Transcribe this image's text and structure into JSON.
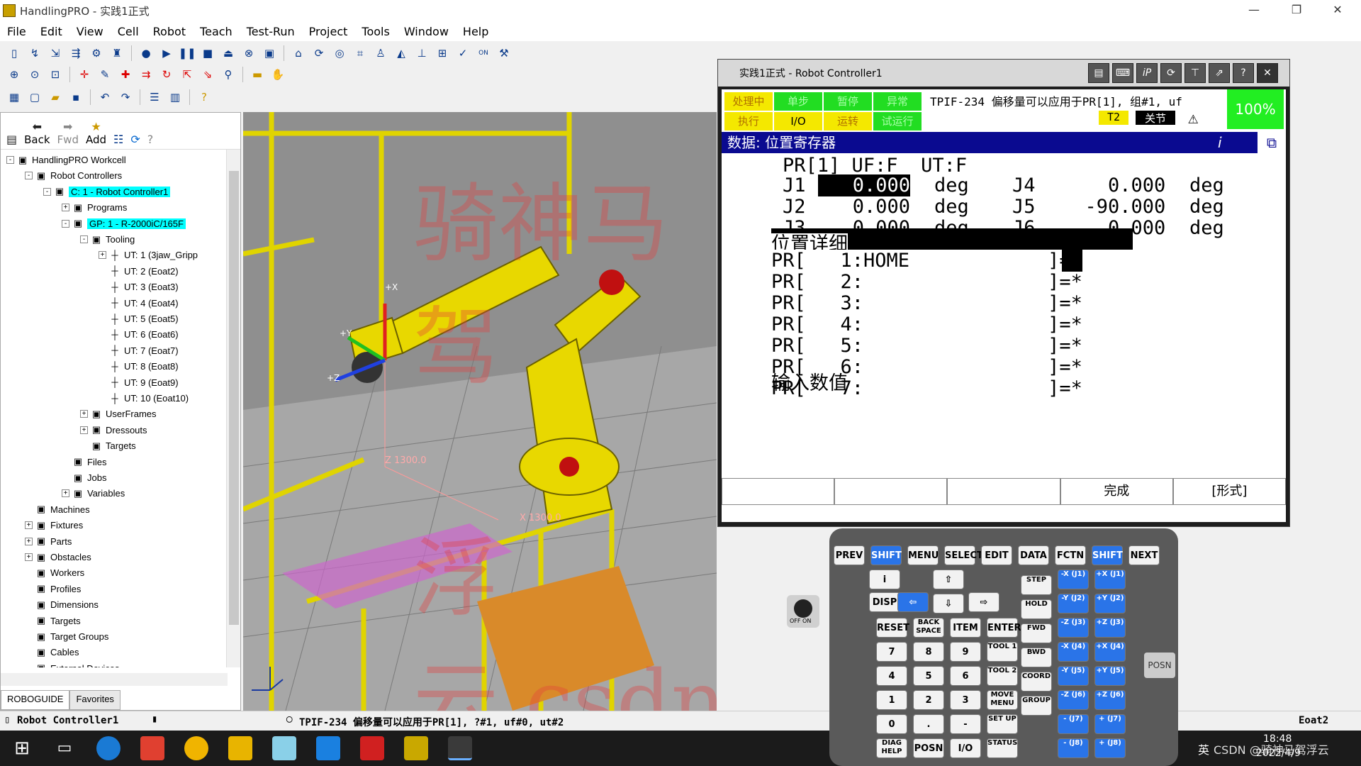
{
  "app": {
    "title": "HandlingPRO - 实践1正式"
  },
  "menu": [
    "File",
    "Edit",
    "View",
    "Cell",
    "Robot",
    "Teach",
    "Test-Run",
    "Project",
    "Tools",
    "Window",
    "Help"
  ],
  "nav": {
    "back": "Back",
    "fwd": "Fwd",
    "add": "Add"
  },
  "tree": [
    {
      "label": "HandlingPRO Workcell",
      "lvl": 0,
      "exp": "-"
    },
    {
      "label": "Robot Controllers",
      "lvl": 1,
      "exp": "-"
    },
    {
      "label": "C: 1 - Robot Controller1",
      "lvl": 2,
      "exp": "-",
      "hl": true
    },
    {
      "label": "Programs",
      "lvl": 3,
      "exp": "+"
    },
    {
      "label": "GP: 1 - R-2000iC/165F",
      "lvl": 3,
      "exp": "-",
      "hl": true
    },
    {
      "label": "Tooling",
      "lvl": 4,
      "exp": "-"
    },
    {
      "label": "UT: 1  (3jaw_Gripp",
      "lvl": 5,
      "exp": "+"
    },
    {
      "label": "UT: 2  (Eoat2)",
      "lvl": 5
    },
    {
      "label": "UT: 3  (Eoat3)",
      "lvl": 5
    },
    {
      "label": "UT: 4  (Eoat4)",
      "lvl": 5
    },
    {
      "label": "UT: 5  (Eoat5)",
      "lvl": 5
    },
    {
      "label": "UT: 6  (Eoat6)",
      "lvl": 5
    },
    {
      "label": "UT: 7  (Eoat7)",
      "lvl": 5
    },
    {
      "label": "UT: 8  (Eoat8)",
      "lvl": 5
    },
    {
      "label": "UT: 9  (Eoat9)",
      "lvl": 5
    },
    {
      "label": "UT: 10  (Eoat10)",
      "lvl": 5
    },
    {
      "label": "UserFrames",
      "lvl": 4,
      "exp": "+"
    },
    {
      "label": "Dressouts",
      "lvl": 4,
      "exp": "+"
    },
    {
      "label": "Targets",
      "lvl": 4
    },
    {
      "label": "Files",
      "lvl": 3
    },
    {
      "label": "Jobs",
      "lvl": 3
    },
    {
      "label": "Variables",
      "lvl": 3,
      "exp": "+"
    },
    {
      "label": "Machines",
      "lvl": 1
    },
    {
      "label": "Fixtures",
      "lvl": 1,
      "exp": "+"
    },
    {
      "label": "Parts",
      "lvl": 1,
      "exp": "+"
    },
    {
      "label": "Obstacles",
      "lvl": 1,
      "exp": "+"
    },
    {
      "label": "Workers",
      "lvl": 1
    },
    {
      "label": "Profiles",
      "lvl": 1
    },
    {
      "label": "Dimensions",
      "lvl": 1
    },
    {
      "label": "Targets",
      "lvl": 1
    },
    {
      "label": "Target Groups",
      "lvl": 1
    },
    {
      "label": "Cables",
      "lvl": 1
    },
    {
      "label": "External Devices",
      "lvl": 1
    }
  ],
  "left_tabs": [
    "ROBOGUIDE",
    "Favorites"
  ],
  "view3d": {
    "z_label": "Z 1300.0",
    "x_label": "X 1300.0",
    "axis_x": "+X",
    "axis_y": "+Y",
    "axis_z": "+Z",
    "wm1": "骑神马驾",
    "wm2": "浮云.csdn"
  },
  "tp": {
    "title": "实践1正式 - Robot Controller1",
    "status_left": [
      "处理中",
      "单步",
      "暂停",
      "异常",
      "执行",
      "I/O",
      "运转",
      "试运行"
    ],
    "message": "TPIF-234 偏移量可以应用于PR[1], 组#1, uf",
    "mode": "T2",
    "off": "关节",
    "percent": "100%",
    "header": "数据: 位置寄存器",
    "pr_line": "PR[1] UF:F  UT:F",
    "joints": [
      {
        "n": "J1",
        "v": "0.000",
        "u": "deg",
        "n2": "J4",
        "v2": "0.000",
        "u2": "deg"
      },
      {
        "n": "J2",
        "v": "0.000",
        "u": "deg",
        "n2": "J5",
        "v2": "-90.000",
        "u2": "deg"
      },
      {
        "n": "J3",
        "v": "0.000",
        "u": "deg",
        "n2": "J6",
        "v2": "0.000",
        "u2": "deg"
      }
    ],
    "detail": "位置详细",
    "prs": [
      "PR[   1:HOME            ]=*",
      "PR[   2:                ]=*",
      "PR[   3:                ]=*",
      "PR[   4:                ]=*",
      "PR[   5:                ]=*",
      "PR[   6:                ]=*",
      "PR[   7:                ]=*"
    ],
    "input": "输入数值",
    "fkeys": [
      "",
      "",
      "",
      "完成",
      "[形式]"
    ]
  },
  "pendant": {
    "row1": [
      "PREV",
      "SHIFT",
      "MENU",
      "SELECT",
      "EDIT",
      "DATA",
      "FCTN",
      "SHIFT",
      "NEXT"
    ],
    "keys": [
      "RESET",
      "BACK SPACE",
      "ITEM",
      "ENTER",
      "7",
      "8",
      "9",
      "TOOL 1",
      "4",
      "5",
      "6",
      "TOOL 2",
      "1",
      "2",
      "3",
      "MOVE MENU",
      "0",
      ".",
      "-",
      "SET UP",
      "DIAG HELP",
      "POSN",
      "I/O",
      "STATUS"
    ],
    "right": [
      "STEP",
      "HOLD",
      "FWD",
      "BWD",
      "COORD",
      "GROUP"
    ],
    "jog": [
      "-X (J1)",
      "+X (J1)",
      "-Y (J2)",
      "+Y (J2)",
      "-Z (J3)",
      "+Z (J3)",
      "-X (J4)",
      "+X (J4)",
      "-Y (J5)",
      "+Y (J5)",
      "-Z (J6)",
      "+Z (J6)",
      "- (J7)",
      "+ (J7)",
      "- (J8)",
      "+ (J8)"
    ],
    "onoff": "OFF  ON",
    "posn": "POSN",
    "disp": "DISP"
  },
  "status": {
    "left": "Robot Controller1",
    "msg": "TPIF-234 偏移量可以应用于PR[1], ?#1, uf#0, ut#2",
    "right": "Eoat2"
  },
  "taskbar": {
    "time": "18:48",
    "date": "2022/4/9",
    "ime": "英",
    "csdn": "CSDN @骑神马驾浮云"
  }
}
